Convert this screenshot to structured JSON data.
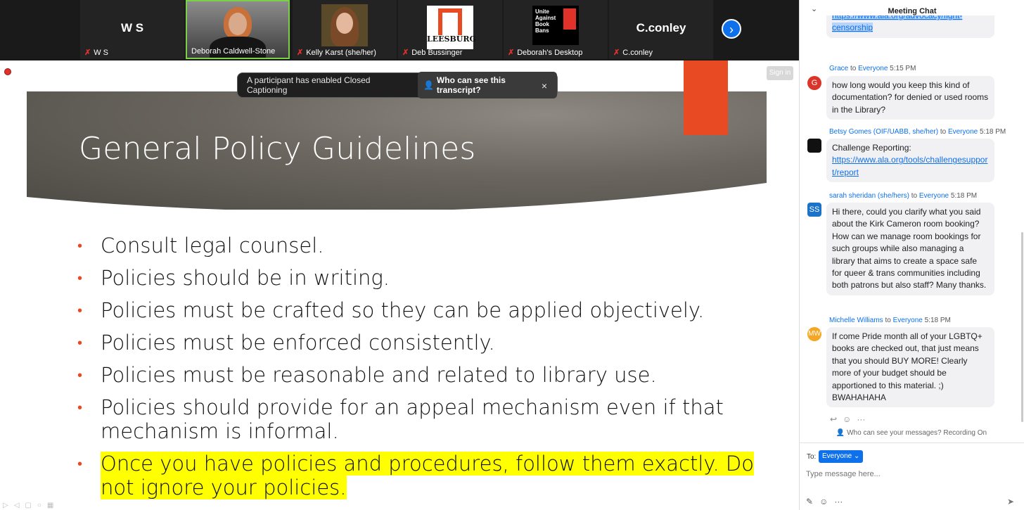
{
  "participants": [
    {
      "big_name": "W S",
      "label": "W S",
      "mic_off": true
    },
    {
      "label": "Deborah Caldwell-Stone",
      "active": true
    },
    {
      "label": "Kelly Karst (she/her)",
      "mic_off": true
    },
    {
      "label": "Deb Bussinger",
      "mic_off": true,
      "logo_text": "LEESBURG"
    },
    {
      "label": "Deborah's Desktop",
      "mic_off": true,
      "logo_text": "Unite Against Book Bans"
    },
    {
      "big_name": "C.conley",
      "label": "C.conley",
      "mic_off": true
    }
  ],
  "strip": {
    "next_icon": "›"
  },
  "toast": {
    "text": "A participant has enabled Closed Captioning",
    "who_label": "Who can see this transcript?",
    "close": "×"
  },
  "sign_in": "Sign in",
  "slide": {
    "title": "General Policy Guidelines",
    "bullets": [
      "Consult legal counsel.",
      "Policies should be in writing.",
      "Policies must be crafted so they can be applied objectively.",
      "Policies must be enforced consistently.",
      "Policies must be reasonable and related to library use.",
      " Policies should provide for an appeal mechanism even if that mechanism is informal.",
      "Once you have policies and procedures, follow them exactly.  Do not ignore your policies."
    ],
    "accent_color": "#e84b24",
    "highlight_color": "#ffff00"
  },
  "chat": {
    "title": "Meeting Chat",
    "messages": [
      {
        "text_top": "https://www.ala.org/advocacy/fight-censorship"
      },
      {
        "avatar": "G",
        "avatar_color": "#d9352a",
        "sender": "Grace",
        "to_word": "to",
        "to": "Everyone",
        "time": "5:15 PM",
        "text": "how long would you keep this kind of documentation?  for denied or used rooms in the Library?"
      },
      {
        "avatar": "",
        "avatar_color": "#111111",
        "sender": "Betsy Gomes (OIF/UABB, she/her)",
        "to_word": "to",
        "to": "Everyone",
        "time": "5:18 PM",
        "text": "Challenge Reporting:",
        "link": "https://www.ala.org/tools/challengesupport/report"
      },
      {
        "avatar": "SS",
        "avatar_color": "#1a73c9",
        "sender": "sarah sheridan (she/hers)",
        "to_word": "to",
        "to": "Everyone",
        "time": "5:18 PM",
        "text": "Hi there, could you clarify what you said about the Kirk Cameron room booking? How can we manage room bookings for such groups while also managing a library that aims to create a space safe for queer & trans communities including both patrons but also staff? Many thanks."
      },
      {
        "avatar": "MW",
        "avatar_color": "#f5a623",
        "sender": "Michelle Williams",
        "to_word": "to",
        "to": "Everyone",
        "time": "5:18 PM",
        "text": "If come Pride month all of your LGBTQ+ books are checked out, that just means that you should BUY MORE!  Clearly more of your budget should be apportioned to this material. ;) BWAHAHAHA"
      }
    ],
    "who_can_see": "Who can see your messages? Recording On",
    "to_label": "To:",
    "to_value": "Everyone",
    "input_placeholder": "Type message here...",
    "more": "···"
  }
}
